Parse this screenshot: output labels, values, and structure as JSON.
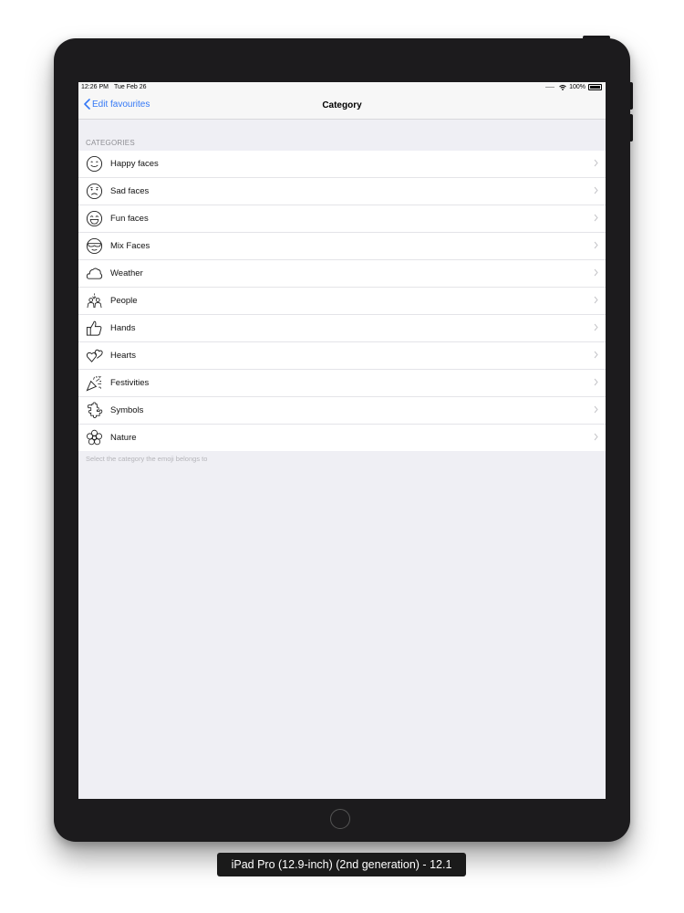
{
  "status_bar": {
    "time": "12:26 PM",
    "date": "Tue Feb 26",
    "battery": "100%"
  },
  "nav": {
    "back_label": "Edit favourites",
    "title": "Category"
  },
  "section": {
    "header": "CATEGORIES",
    "footer": "Select the category the emoji belongs to"
  },
  "categories": [
    {
      "label": "Happy faces",
      "icon": "happy-face-icon"
    },
    {
      "label": "Sad faces",
      "icon": "sad-face-icon"
    },
    {
      "label": "Fun faces",
      "icon": "fun-face-icon"
    },
    {
      "label": "Mix Faces",
      "icon": "mix-face-icon"
    },
    {
      "label": "Weather",
      "icon": "cloud-icon"
    },
    {
      "label": "People",
      "icon": "people-icon"
    },
    {
      "label": "Hands",
      "icon": "thumbs-up-icon"
    },
    {
      "label": "Hearts",
      "icon": "hearts-icon"
    },
    {
      "label": "Festivities",
      "icon": "party-popper-icon"
    },
    {
      "label": "Symbols",
      "icon": "puzzle-icon"
    },
    {
      "label": "Nature",
      "icon": "flower-icon"
    }
  ],
  "simulator_caption": "iPad Pro (12.9-inch) (2nd generation) - 12.1",
  "colors": {
    "accent": "#3478f6",
    "device": "#1c1b1d",
    "background": "#efeff4"
  }
}
